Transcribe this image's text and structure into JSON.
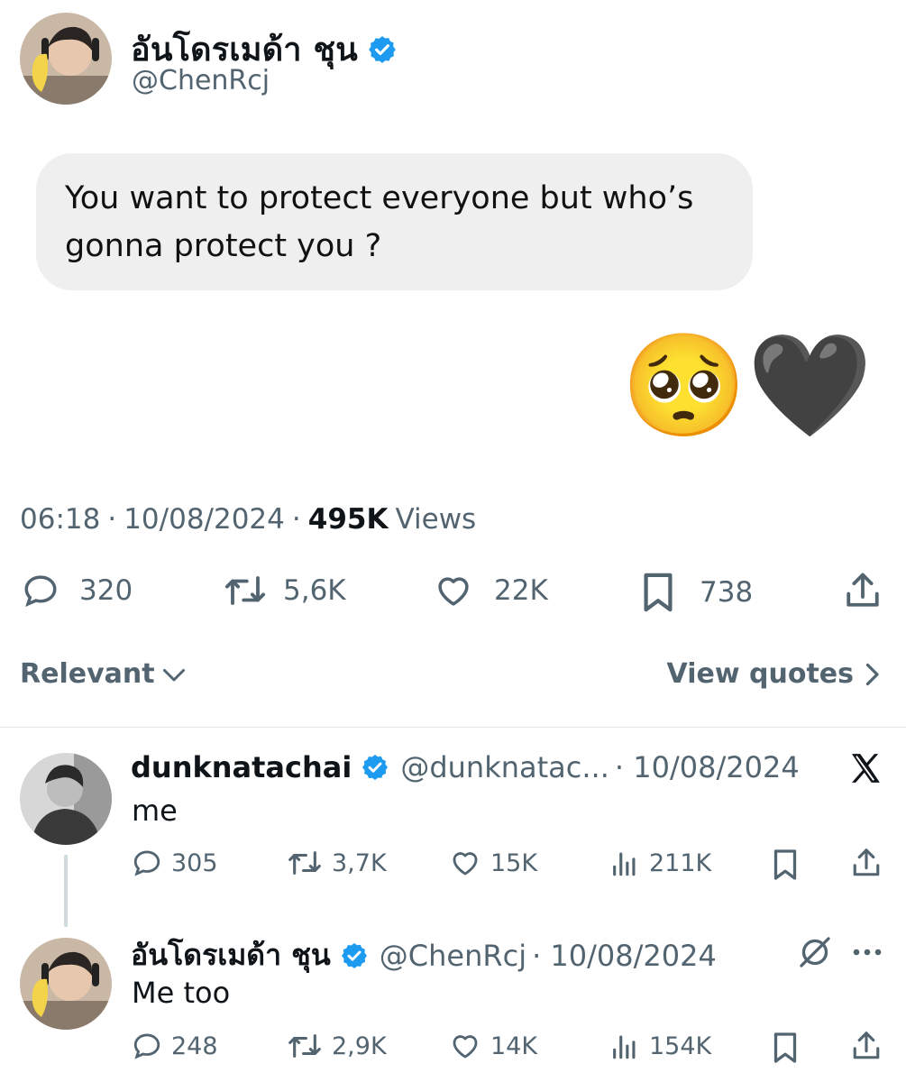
{
  "tweet": {
    "author_name": "อันโดรเมด้า ชุน",
    "author_handle": "@ChenRcj",
    "text_line1": "You want to protect everyone but who’s",
    "text_line2": "gonna protect you ?",
    "emojis": "🥺🖤",
    "time": "06:18",
    "date": "10/08/2024",
    "views_count": "495K",
    "views_label": "Views",
    "separator": "·",
    "stats": {
      "replies": "320",
      "reposts": "5,6K",
      "likes": "22K",
      "bookmarks": "738"
    }
  },
  "filter": {
    "sort_label": "Relevant",
    "view_quotes_label": "View quotes"
  },
  "replies": [
    {
      "name": "dunknatachai",
      "handle": "@dunknatac...",
      "date": "· 10/08/2024",
      "text": "me",
      "stats": {
        "replies": "305",
        "reposts": "3,7K",
        "likes": "15K",
        "views": "211K"
      }
    },
    {
      "name": "อันโดรเมด้า ชุน",
      "handle": "@ChenRcj",
      "date": "· 10/08/2024",
      "text": "Me too",
      "stats": {
        "replies": "248",
        "reposts": "2,9K",
        "likes": "14K",
        "views": "154K"
      }
    }
  ],
  "colors": {
    "verified": "#1d9bf0",
    "secondary_text": "#536471",
    "bubble": "#efefef"
  },
  "icons": [
    "verified-icon",
    "reply-icon",
    "repost-icon",
    "like-icon",
    "bookmark-icon",
    "share-icon",
    "views-icon",
    "chevron-down-icon",
    "chevron-right-icon",
    "x-logo-icon",
    "grok-icon",
    "more-icon"
  ]
}
